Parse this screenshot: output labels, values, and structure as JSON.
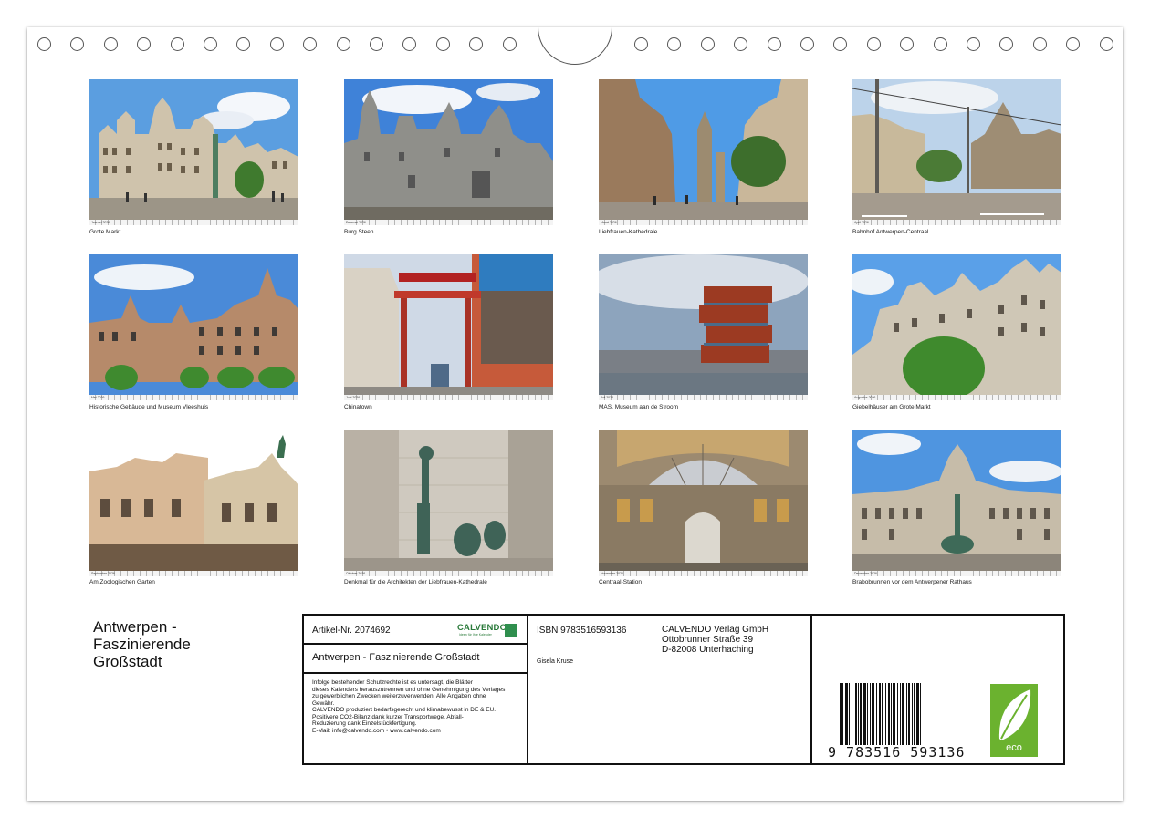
{
  "cells": [
    {
      "caption": "Grote Markt",
      "month": "Januari 2026"
    },
    {
      "caption": "Burg Steen",
      "month": "Februari 2026"
    },
    {
      "caption": "Liebfrauen-Kathedrale",
      "month": "Maart 2026"
    },
    {
      "caption": "Bahnhof Antwerpen-Centraal",
      "month": "April 2026"
    },
    {
      "caption": "Historische Gebäude und Museum Vleeshuis",
      "month": "Mei 2026"
    },
    {
      "caption": "Chinatown",
      "month": "Juni 2026"
    },
    {
      "caption": "MAS, Museum aan de Stroom",
      "month": "Juli 2026"
    },
    {
      "caption": "Giebelhäuser am Grote Markt",
      "month": "Augustus 2026"
    },
    {
      "caption": "Am Zoologischen Garten",
      "month": "September 2026"
    },
    {
      "caption": "Denkmal für die Architekten der Liebfrauen-Kathedrale",
      "month": "Oktober 2026"
    },
    {
      "caption": "Centraal-Station",
      "month": "November 2026"
    },
    {
      "caption": "Brabobrunnen vor dem Antwerpener Rathaus",
      "month": "December 2026"
    }
  ],
  "title": {
    "line1": "Antwerpen -",
    "line2": "Faszinierende",
    "line3": "Großstadt"
  },
  "info": {
    "article": "Artikel-Nr. 2074692",
    "brand": "CALVENDO",
    "brand_sub": "Ideen für Ihre Kalender",
    "product_title": "Antwerpen - Faszinierende Großstadt",
    "legal_lines": [
      "Infolge bestehender Schutzrechte ist es untersagt, die Blätter",
      "dieses Kalenders herauszutrennen und ohne Genehmigung des Verlages",
      "zu gewerblichen Zwecken weiterzuverwenden. Alle Angaben ohne",
      "Gewähr.",
      "CALVENDO produziert bedarfsgerecht und klimabewusst in DE & EU.",
      "Positivere CO2-Bilanz dank kurzer Transportwege. Abfall-",
      "Reduzierung dank Einzelstückfertigung.",
      "E-Mail: info@calvendo.com • www.calvendo.com"
    ],
    "isbn": "ISBN 9783516593136",
    "author": "Gisela Kruse",
    "publisher_line1": "CALVENDO Verlag GmbH",
    "publisher_line2": "Ottobrunner Straße 39",
    "publisher_line3": "D-82008 Unterhaching",
    "barcode_number": "9 783516 593136",
    "eco_label": "eco"
  }
}
